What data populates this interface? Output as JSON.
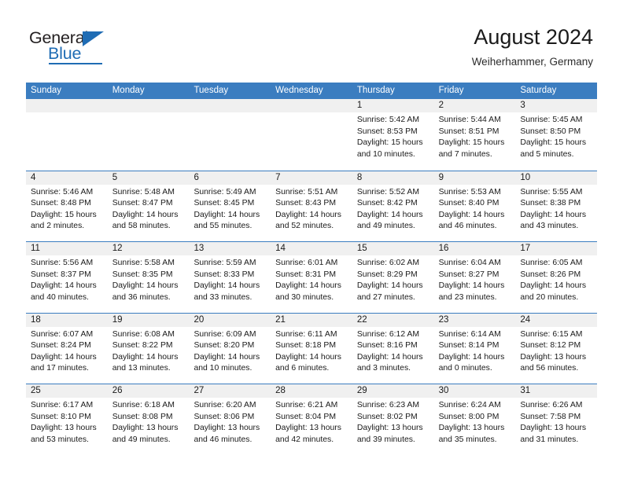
{
  "brand": {
    "name_part1": "General",
    "name_part2": "Blue",
    "accent_color": "#1f6cb4"
  },
  "header": {
    "title": "August 2024",
    "subtitle": "Weiherhammer, Germany"
  },
  "calendar": {
    "header_bg": "#3b7dc0",
    "weekdays": [
      "Sunday",
      "Monday",
      "Tuesday",
      "Wednesday",
      "Thursday",
      "Friday",
      "Saturday"
    ],
    "weeks": [
      [
        {
          "day": "",
          "sunrise": "",
          "sunset": "",
          "daylight": "",
          "daylight2": ""
        },
        {
          "day": "",
          "sunrise": "",
          "sunset": "",
          "daylight": "",
          "daylight2": ""
        },
        {
          "day": "",
          "sunrise": "",
          "sunset": "",
          "daylight": "",
          "daylight2": ""
        },
        {
          "day": "",
          "sunrise": "",
          "sunset": "",
          "daylight": "",
          "daylight2": ""
        },
        {
          "day": "1",
          "sunrise": "Sunrise: 5:42 AM",
          "sunset": "Sunset: 8:53 PM",
          "daylight": "Daylight: 15 hours",
          "daylight2": "and 10 minutes."
        },
        {
          "day": "2",
          "sunrise": "Sunrise: 5:44 AM",
          "sunset": "Sunset: 8:51 PM",
          "daylight": "Daylight: 15 hours",
          "daylight2": "and 7 minutes."
        },
        {
          "day": "3",
          "sunrise": "Sunrise: 5:45 AM",
          "sunset": "Sunset: 8:50 PM",
          "daylight": "Daylight: 15 hours",
          "daylight2": "and 5 minutes."
        }
      ],
      [
        {
          "day": "4",
          "sunrise": "Sunrise: 5:46 AM",
          "sunset": "Sunset: 8:48 PM",
          "daylight": "Daylight: 15 hours",
          "daylight2": "and 2 minutes."
        },
        {
          "day": "5",
          "sunrise": "Sunrise: 5:48 AM",
          "sunset": "Sunset: 8:47 PM",
          "daylight": "Daylight: 14 hours",
          "daylight2": "and 58 minutes."
        },
        {
          "day": "6",
          "sunrise": "Sunrise: 5:49 AM",
          "sunset": "Sunset: 8:45 PM",
          "daylight": "Daylight: 14 hours",
          "daylight2": "and 55 minutes."
        },
        {
          "day": "7",
          "sunrise": "Sunrise: 5:51 AM",
          "sunset": "Sunset: 8:43 PM",
          "daylight": "Daylight: 14 hours",
          "daylight2": "and 52 minutes."
        },
        {
          "day": "8",
          "sunrise": "Sunrise: 5:52 AM",
          "sunset": "Sunset: 8:42 PM",
          "daylight": "Daylight: 14 hours",
          "daylight2": "and 49 minutes."
        },
        {
          "day": "9",
          "sunrise": "Sunrise: 5:53 AM",
          "sunset": "Sunset: 8:40 PM",
          "daylight": "Daylight: 14 hours",
          "daylight2": "and 46 minutes."
        },
        {
          "day": "10",
          "sunrise": "Sunrise: 5:55 AM",
          "sunset": "Sunset: 8:38 PM",
          "daylight": "Daylight: 14 hours",
          "daylight2": "and 43 minutes."
        }
      ],
      [
        {
          "day": "11",
          "sunrise": "Sunrise: 5:56 AM",
          "sunset": "Sunset: 8:37 PM",
          "daylight": "Daylight: 14 hours",
          "daylight2": "and 40 minutes."
        },
        {
          "day": "12",
          "sunrise": "Sunrise: 5:58 AM",
          "sunset": "Sunset: 8:35 PM",
          "daylight": "Daylight: 14 hours",
          "daylight2": "and 36 minutes."
        },
        {
          "day": "13",
          "sunrise": "Sunrise: 5:59 AM",
          "sunset": "Sunset: 8:33 PM",
          "daylight": "Daylight: 14 hours",
          "daylight2": "and 33 minutes."
        },
        {
          "day": "14",
          "sunrise": "Sunrise: 6:01 AM",
          "sunset": "Sunset: 8:31 PM",
          "daylight": "Daylight: 14 hours",
          "daylight2": "and 30 minutes."
        },
        {
          "day": "15",
          "sunrise": "Sunrise: 6:02 AM",
          "sunset": "Sunset: 8:29 PM",
          "daylight": "Daylight: 14 hours",
          "daylight2": "and 27 minutes."
        },
        {
          "day": "16",
          "sunrise": "Sunrise: 6:04 AM",
          "sunset": "Sunset: 8:27 PM",
          "daylight": "Daylight: 14 hours",
          "daylight2": "and 23 minutes."
        },
        {
          "day": "17",
          "sunrise": "Sunrise: 6:05 AM",
          "sunset": "Sunset: 8:26 PM",
          "daylight": "Daylight: 14 hours",
          "daylight2": "and 20 minutes."
        }
      ],
      [
        {
          "day": "18",
          "sunrise": "Sunrise: 6:07 AM",
          "sunset": "Sunset: 8:24 PM",
          "daylight": "Daylight: 14 hours",
          "daylight2": "and 17 minutes."
        },
        {
          "day": "19",
          "sunrise": "Sunrise: 6:08 AM",
          "sunset": "Sunset: 8:22 PM",
          "daylight": "Daylight: 14 hours",
          "daylight2": "and 13 minutes."
        },
        {
          "day": "20",
          "sunrise": "Sunrise: 6:09 AM",
          "sunset": "Sunset: 8:20 PM",
          "daylight": "Daylight: 14 hours",
          "daylight2": "and 10 minutes."
        },
        {
          "day": "21",
          "sunrise": "Sunrise: 6:11 AM",
          "sunset": "Sunset: 8:18 PM",
          "daylight": "Daylight: 14 hours",
          "daylight2": "and 6 minutes."
        },
        {
          "day": "22",
          "sunrise": "Sunrise: 6:12 AM",
          "sunset": "Sunset: 8:16 PM",
          "daylight": "Daylight: 14 hours",
          "daylight2": "and 3 minutes."
        },
        {
          "day": "23",
          "sunrise": "Sunrise: 6:14 AM",
          "sunset": "Sunset: 8:14 PM",
          "daylight": "Daylight: 14 hours",
          "daylight2": "and 0 minutes."
        },
        {
          "day": "24",
          "sunrise": "Sunrise: 6:15 AM",
          "sunset": "Sunset: 8:12 PM",
          "daylight": "Daylight: 13 hours",
          "daylight2": "and 56 minutes."
        }
      ],
      [
        {
          "day": "25",
          "sunrise": "Sunrise: 6:17 AM",
          "sunset": "Sunset: 8:10 PM",
          "daylight": "Daylight: 13 hours",
          "daylight2": "and 53 minutes."
        },
        {
          "day": "26",
          "sunrise": "Sunrise: 6:18 AM",
          "sunset": "Sunset: 8:08 PM",
          "daylight": "Daylight: 13 hours",
          "daylight2": "and 49 minutes."
        },
        {
          "day": "27",
          "sunrise": "Sunrise: 6:20 AM",
          "sunset": "Sunset: 8:06 PM",
          "daylight": "Daylight: 13 hours",
          "daylight2": "and 46 minutes."
        },
        {
          "day": "28",
          "sunrise": "Sunrise: 6:21 AM",
          "sunset": "Sunset: 8:04 PM",
          "daylight": "Daylight: 13 hours",
          "daylight2": "and 42 minutes."
        },
        {
          "day": "29",
          "sunrise": "Sunrise: 6:23 AM",
          "sunset": "Sunset: 8:02 PM",
          "daylight": "Daylight: 13 hours",
          "daylight2": "and 39 minutes."
        },
        {
          "day": "30",
          "sunrise": "Sunrise: 6:24 AM",
          "sunset": "Sunset: 8:00 PM",
          "daylight": "Daylight: 13 hours",
          "daylight2": "and 35 minutes."
        },
        {
          "day": "31",
          "sunrise": "Sunrise: 6:26 AM",
          "sunset": "Sunset: 7:58 PM",
          "daylight": "Daylight: 13 hours",
          "daylight2": "and 31 minutes."
        }
      ]
    ]
  }
}
